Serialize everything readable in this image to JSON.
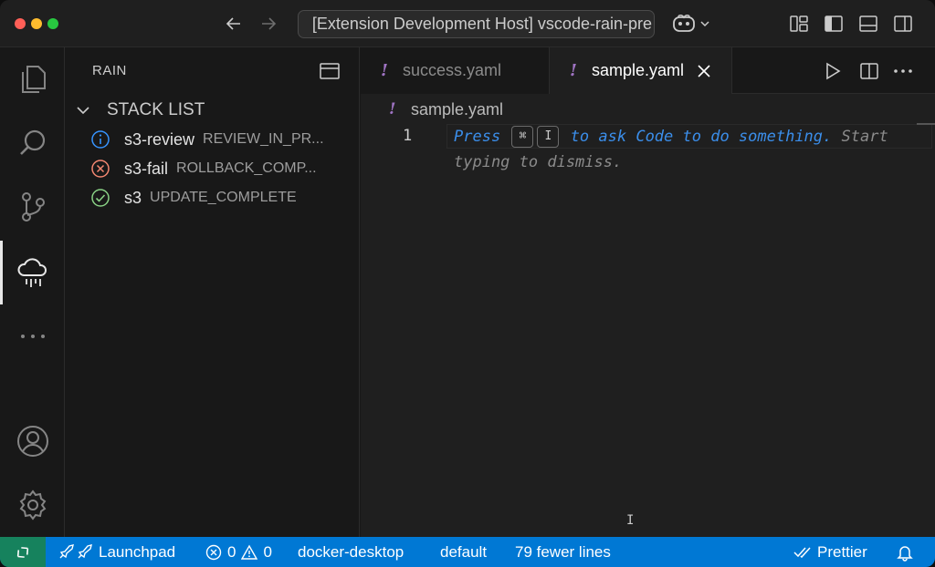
{
  "window": {
    "title": "[Extension Development Host] vscode-rain-pre"
  },
  "sidebar": {
    "title": "RAIN",
    "section_label": "STACK LIST",
    "stacks": [
      {
        "name": "s3-review",
        "status": "REVIEW_IN_PR...",
        "icon": "info-icon",
        "color": "#3794ff"
      },
      {
        "name": "s3-fail",
        "status": "ROLLBACK_COMP...",
        "icon": "error-icon",
        "color": "#f48771"
      },
      {
        "name": "s3",
        "status": "UPDATE_COMPLETE",
        "icon": "check-icon",
        "color": "#89d185"
      }
    ]
  },
  "tabs": [
    {
      "label": "success.yaml",
      "icon": "!",
      "active": false
    },
    {
      "label": "sample.yaml",
      "icon": "!",
      "active": true
    }
  ],
  "editor": {
    "breadcrumb_icon": "!",
    "breadcrumb": "sample.yaml",
    "line_number": "1",
    "hint": {
      "press": "Press",
      "key1": "⌘",
      "key2": "I",
      "ask": "to ask Code to do something.",
      "start": " Start",
      "dismiss": "typing to dismiss."
    }
  },
  "statusbar": {
    "launchpad": "Launchpad",
    "errors": "0",
    "warnings": "0",
    "context": "docker-desktop",
    "namespace": "default",
    "diff": "79 fewer lines",
    "formatter": "Prettier"
  },
  "colors": {
    "statusbar_bg": "#0078d4",
    "remote_bg": "#16825d",
    "yaml_icon": "#a074c4",
    "accent_blue": "#3b8eea"
  }
}
